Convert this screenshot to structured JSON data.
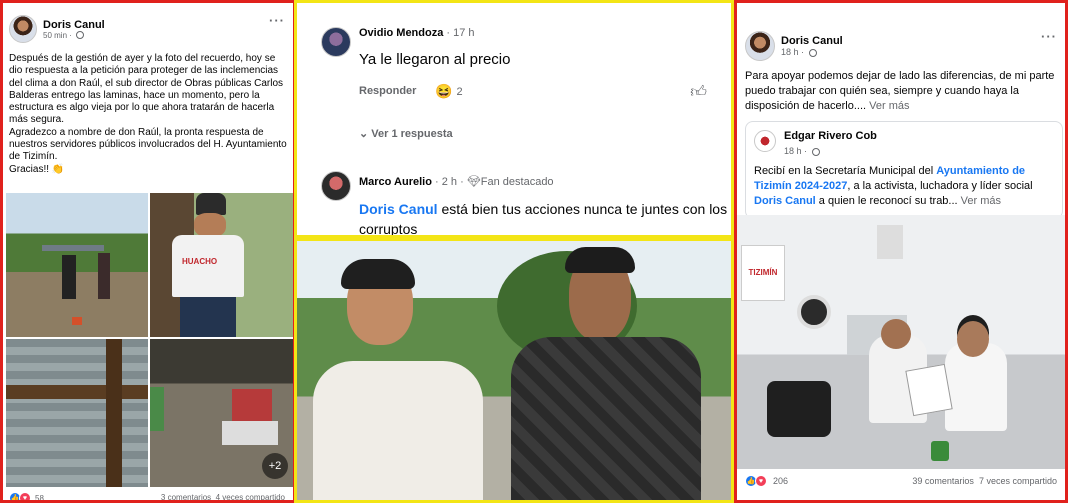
{
  "post_left": {
    "author": "Doris Canul",
    "time": "50 min",
    "body": "Después de la gestión de ayer y la foto del recuerdo, hoy se dio respuesta a la petición para proteger de las inclemencias del clima a don Raúl, el sub director de Obras públicas Carlos Balderas entrego las laminas, hace un momento, pero la estructura es algo vieja por lo que ahora tratarán de hacerla más segura.",
    "body2": "Agradezco a nombre de don Raúl, la pronta respuesta de nuestros servidores públicos involucrados del  H. Ayuntamiento de Tizimín.",
    "body3": "Gracias!! 👏",
    "shirt_text": "HUACHO",
    "more_photos": "+2",
    "reaction_count": "58",
    "comments": "3 comentarios",
    "shares": "4 veces compartido"
  },
  "comments_panel": {
    "c1_author": "Ovidio Mendoza",
    "c1_time": "· 17 h",
    "c1_text": "Ya le llegaron al precio",
    "reply_label": "Responder",
    "reaction_count": "2",
    "view_replies": "Ver 1 respuesta",
    "c2_author": "Marco Aurelio",
    "c2_time": "· 2 h ·",
    "c2_badge": "Fan destacado",
    "c2_mention": "Doris Canul",
    "c2_text": " está bien tus acciones  nunca te juntes con los corruptos"
  },
  "post_right": {
    "author": "Doris Canul",
    "time": "18 h ·",
    "body": "Para apoyar podemos dejar de lado las diferencias, de mi parte puedo trabajar con quién sea, siempre y cuando haya la disposición de hacerlo....",
    "see_more": "Ver más",
    "shared_author": "Edgar Rivero Cob",
    "shared_time": "18 h ·",
    "shared_prefix": "Recibí en la Secretaría Municipal del ",
    "shared_link1": "Ayuntamiento de Tizimín 2024-2027",
    "shared_mid": ", a la activista, luchadora y líder social ",
    "shared_link2": "Doris Canul",
    "shared_suffix": " a quien le reconocí su trab...",
    "shared_see_more": "Ver más",
    "sign_text": "TIZIMÍN",
    "reaction_count": "206",
    "comments": "39 comentarios",
    "shares": "7 veces compartido"
  },
  "colors": {
    "accent": "#1877f2",
    "border_red": "#e0211d",
    "border_yellow": "#f3e516",
    "text_gray": "#65676b"
  }
}
